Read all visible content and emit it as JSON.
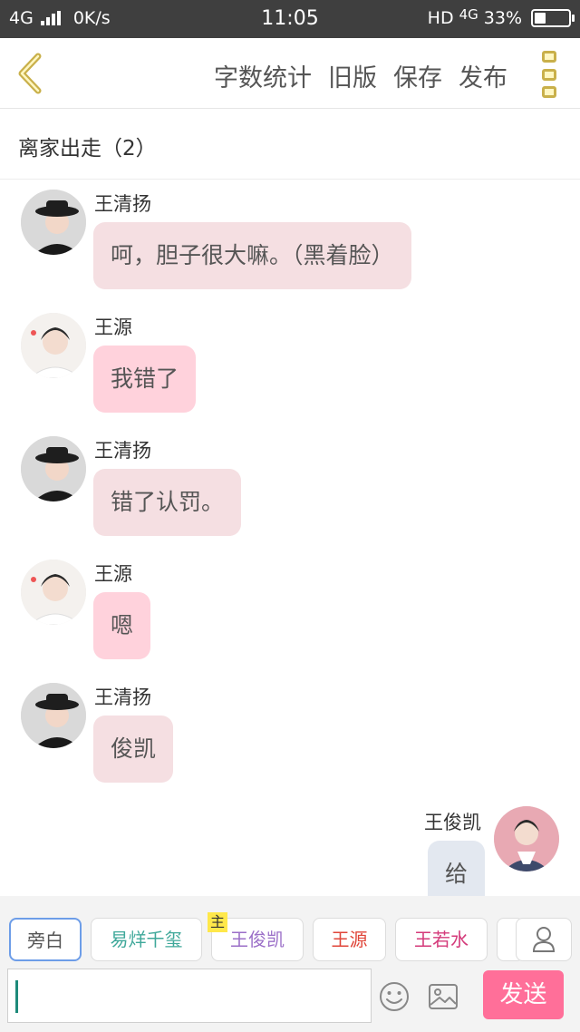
{
  "status_bar": {
    "network": "4G",
    "speed": "0K/s",
    "time": "11:05",
    "hd": "HD",
    "network_right": "4G",
    "battery": "33%",
    "battery_level": 0.33
  },
  "toolbar": {
    "back_icon": "chevron-left-icon",
    "actions": [
      "字数统计",
      "旧版",
      "保存",
      "发布"
    ],
    "more_icon": "more-vertical-icon",
    "accent_color": "#c9b04a"
  },
  "chapter": {
    "title": "离家出走（2）"
  },
  "messages": [
    {
      "sender": "王清扬",
      "text": "呵，胆子很大嘛。（黑着脸）",
      "side": "left",
      "avatar": "avatar-wang-qingyang",
      "bubble_color": "#f5dfe2"
    },
    {
      "sender": "王源",
      "text": "我错了",
      "side": "left",
      "avatar": "avatar-wang-yuan",
      "bubble_color": "#ffd2dc"
    },
    {
      "sender": "王清扬",
      "text": "错了认罚。",
      "side": "left",
      "avatar": "avatar-wang-qingyang",
      "bubble_color": "#f5dfe2"
    },
    {
      "sender": "王源",
      "text": "嗯",
      "side": "left",
      "avatar": "avatar-wang-yuan",
      "bubble_color": "#ffd2dc"
    },
    {
      "sender": "王清扬",
      "text": "俊凯",
      "side": "left",
      "avatar": "avatar-wang-qingyang",
      "bubble_color": "#f5dfe2"
    },
    {
      "sender": "王俊凯",
      "text": "给",
      "side": "right",
      "avatar": "avatar-wang-junkai",
      "bubble_color": "#e3e8f0"
    }
  ],
  "characters": {
    "items": [
      {
        "label": "旁白",
        "color": "#555555",
        "selected": true
      },
      {
        "label": "易烊千玺",
        "color": "#3fa89a"
      },
      {
        "label": "王俊凯",
        "color": "#9b6fc8",
        "host_tag": "主"
      },
      {
        "label": "王源",
        "color": "#e0463a"
      },
      {
        "label": "王若水",
        "color": "#d43a7a"
      },
      {
        "label": "",
        "color": "#555555"
      }
    ],
    "user_icon": "user-icon"
  },
  "input": {
    "value": "",
    "placeholder": "",
    "emoji_icon": "smiley-icon",
    "image_icon": "image-icon",
    "send_label": "发送",
    "send_color": "#ff6f99"
  }
}
